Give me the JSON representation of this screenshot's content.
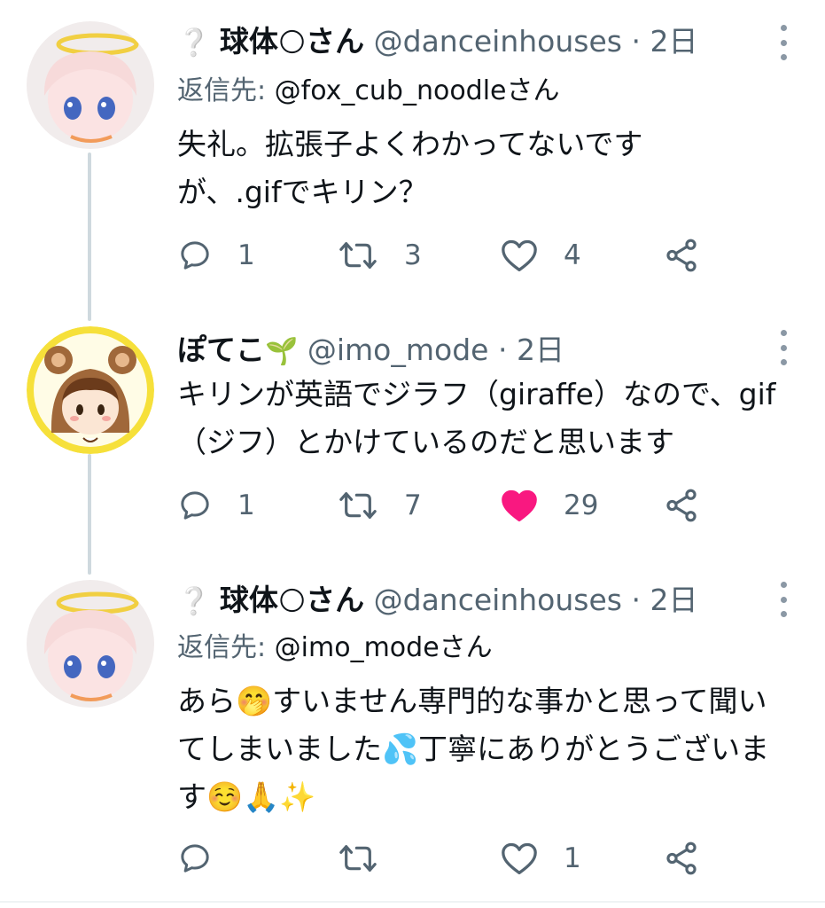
{
  "tweets": [
    {
      "name_prefix": "❔",
      "name": "球体",
      "name_emoji": "🌕",
      "name_suffix": "さん",
      "handle": "@danceinhouses",
      "sep": "·",
      "time": "2日",
      "reply_label": "返信先:",
      "reply_handle": "@fox_cub_noodleさん",
      "text": "失礼。拡張子よくわかってないですが、.gifでキリン？",
      "replies": "1",
      "retweets": "3",
      "likes": "4",
      "liked": false
    },
    {
      "name": "ぽてこ",
      "name_emoji": "🌱",
      "handle": "@imo_mode",
      "sep": "·",
      "time": "2日",
      "text": "キリンが英語でジラフ（giraffe）なので、gif（ジフ）とかけているのだと思います",
      "replies": "1",
      "retweets": "7",
      "likes": "29",
      "liked": true
    },
    {
      "name_prefix": "❔",
      "name": "球体",
      "name_emoji": "🌕",
      "name_suffix": "さん",
      "handle": "@danceinhouses",
      "sep": "·",
      "time": "2日",
      "reply_label": "返信先:",
      "reply_handle": "@imo_modeさん",
      "text": "あら🤭すいません専門的な事かと思って聞いてしまいました💦丁寧にありがとうございます☺️🙏✨",
      "replies": "",
      "retweets": "",
      "likes": "1",
      "liked": false
    }
  ],
  "colors": {
    "text": "#0f1419",
    "secondary": "#536471",
    "like_active": "#f91880",
    "thread_line": "#cfd9de"
  },
  "icons": {
    "reply": "reply-bubble-icon",
    "retweet": "retweet-icon",
    "like": "heart-icon",
    "share": "share-icon",
    "more": "more-vertical-icon"
  }
}
